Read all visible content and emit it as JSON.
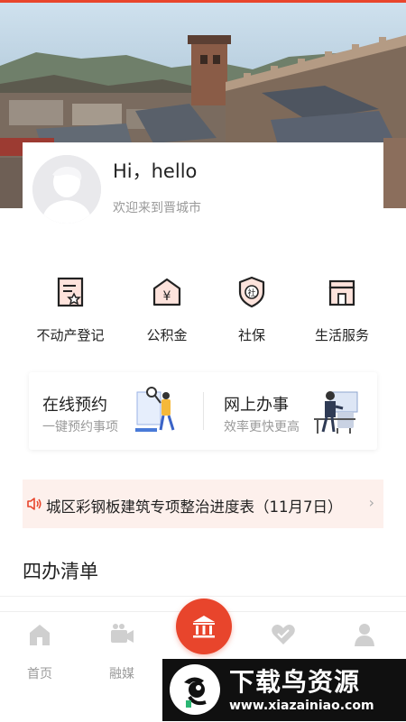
{
  "profile": {
    "greeting": "Hi，hello",
    "welcome": "欢迎来到晋城市"
  },
  "services": [
    {
      "label": "不动产登记",
      "icon": "property-registration-icon"
    },
    {
      "label": "公积金",
      "icon": "housing-fund-icon"
    },
    {
      "label": "社保",
      "icon": "social-security-icon"
    },
    {
      "label": "生活服务",
      "icon": "life-service-icon"
    }
  ],
  "quick_cards": [
    {
      "title": "在线预约",
      "subtitle": "一键预约事项"
    },
    {
      "title": "网上办事",
      "subtitle": "效率更快更高"
    }
  ],
  "notice": {
    "text": "城区彩钢板建筑专项整治进度表（11月7日）",
    "icon": "speaker-icon"
  },
  "section": {
    "title": "四办清单"
  },
  "tabbar": {
    "items": [
      {
        "label": "首页",
        "icon": "home-icon"
      },
      {
        "label": "融媒",
        "icon": "video-camera-icon"
      },
      {
        "label": "",
        "icon": "government-building-icon"
      },
      {
        "label": "",
        "icon": "heart-icon"
      },
      {
        "label": "",
        "icon": "user-icon"
      }
    ]
  },
  "watermark": {
    "title": "下载鸟资源",
    "url": "www.xiazainiao.com"
  },
  "colors": {
    "accent": "#e8452c",
    "notice_bg": "#fdf0ec",
    "muted_text": "#9a9a9a"
  }
}
